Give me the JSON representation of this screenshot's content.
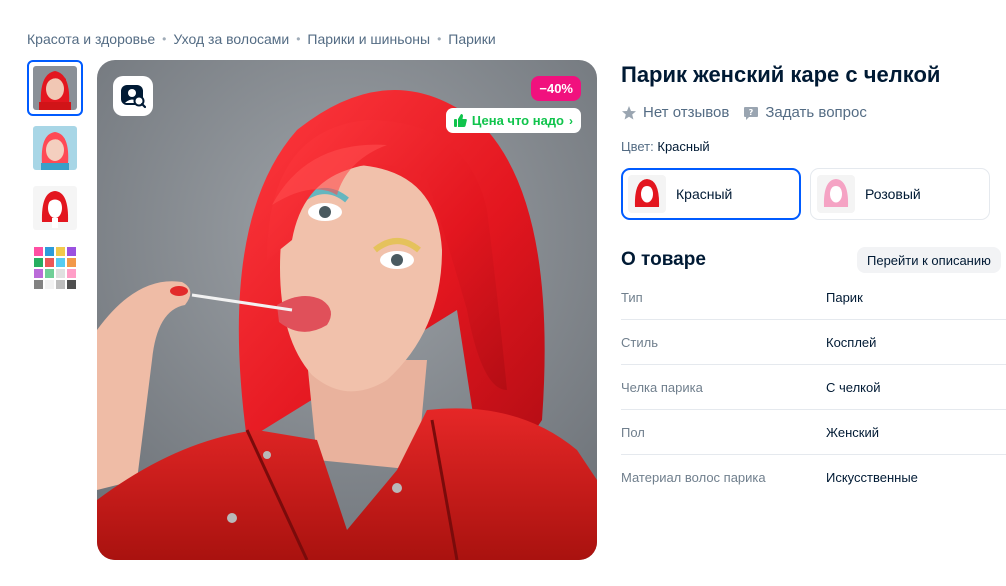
{
  "breadcrumbs": [
    "Красота и здоровье",
    "Уход за волосами",
    "Парики и шиньоны",
    "Парики"
  ],
  "gallery": {
    "discount_badge": "−40%",
    "price_tag": "Цена что надо",
    "thumbnails_count": 4
  },
  "product": {
    "title": "Парик женский каре с челкой",
    "reviews_text": "Нет отзывов",
    "ask_text": "Задать вопрос",
    "color_label": "Цвет:",
    "color_value": "Красный"
  },
  "variants": [
    {
      "label": "Красный",
      "selected": true
    },
    {
      "label": "Розовый",
      "selected": false
    }
  ],
  "about": {
    "title": "О товаре",
    "goto_button": "Перейти к описанию",
    "properties": [
      {
        "label": "Тип",
        "value": "Парик"
      },
      {
        "label": "Стиль",
        "value": "Косплей"
      },
      {
        "label": "Челка парика",
        "value": "С челкой"
      },
      {
        "label": "Пол",
        "value": "Женский"
      },
      {
        "label": "Материал волос парика",
        "value": "Искусственные"
      }
    ]
  },
  "colors": {
    "accent": "#005bff",
    "discount": "#f1117e",
    "price_green": "#10c44c",
    "hair_red": "#e3161f"
  }
}
